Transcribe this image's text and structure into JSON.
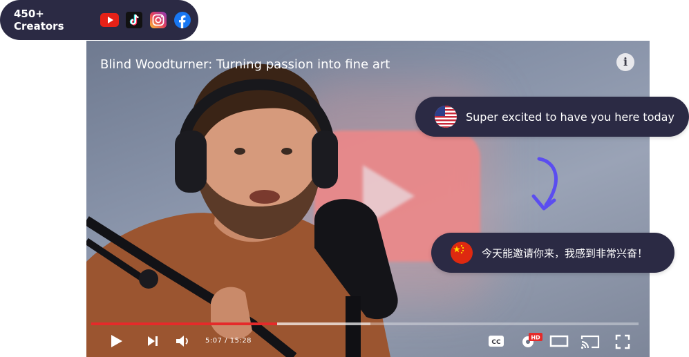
{
  "creators": {
    "label": "450+ Creators",
    "platforms": [
      "youtube-icon",
      "tiktok-icon",
      "instagram-icon",
      "facebook-icon"
    ]
  },
  "video": {
    "title": "Blind Woodturner: Turning passion into fine art",
    "progress": 0.34,
    "buffered": 0.51,
    "time_current": "5:07",
    "time_separator": "/",
    "time_total": "15:28",
    "quality_badge": "HD",
    "controls": [
      "play-icon",
      "next-icon",
      "volume-icon",
      "captions-icon",
      "settings-icon",
      "theater-icon",
      "cast-icon",
      "fullscreen-icon"
    ]
  },
  "translation": {
    "source_text": "Super excited to have you here today",
    "source_flag": "us-flag-icon",
    "target_text": "今天能邀请你来，我感到非常兴奋！",
    "target_flag": "china-flag-icon"
  },
  "colors": {
    "pill_bg": "#2b2a44",
    "progress": "#e52a2a",
    "arrow": "#5b4df0"
  }
}
